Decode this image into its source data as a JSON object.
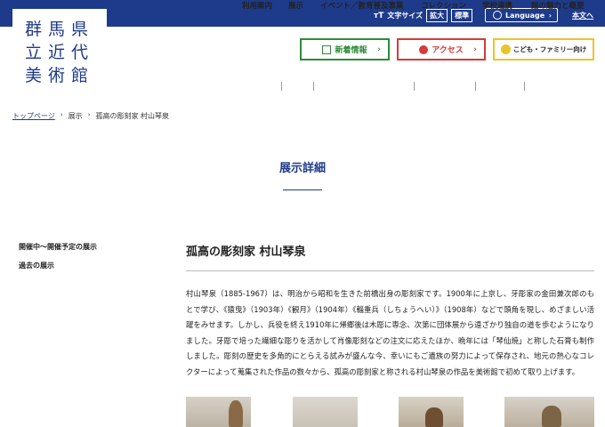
{
  "logo": {
    "lines": [
      "群馬県",
      "立近代",
      "美術館"
    ]
  },
  "utility": {
    "font_size_label": "文字サイズ",
    "enlarge": "拡大",
    "standard": "標準",
    "language": "Language",
    "main_text": "本文へ"
  },
  "cta": {
    "news": "新着情報",
    "access": "アクセス",
    "family": "こども・ファミリー向け"
  },
  "gnav": [
    "利用案内",
    "展示",
    "イベント／教育普及事業",
    "コレクション",
    "学校連携",
    "館の魅力と概要"
  ],
  "breadcrumb": {
    "home": "トップページ",
    "exhibit": "展示",
    "current": "孤高の彫刻家 村山琴泉"
  },
  "page_title": "展示詳細",
  "sidebar": [
    "開催中～開催予定の展示",
    "過去の展示"
  ],
  "article": {
    "title": "孤高の彫刻家 村山琴泉",
    "body": "村山琴泉（1885-1967）は、明治から昭和を生きた前橋出身の彫刻家です。1900年に上京し、牙彫家の金田兼次郎のもとで学び、《猿曳》（1903年）《観月》（1904年）《輜重兵（しちょうへい）》（1908年）などで頭角を現し、めざましい活躍をみせます。しかし、兵役を終え1910年に帰郷後は木彫に専念、次第に団体展から遠ざかり独自の道を歩むようになりました。牙彫で培った繊細な彫りを活かして肖像彫刻などの注文に応えたほか、晩年には「琴仙焼」と称した石膏も制作しました。彫刻の歴史を多角的にとらえる試みが盛んな今、幸いにもご遺族の努力によって保存され、地元の熱心なコレクターによって蒐集された作品の数々から、孤高の彫刻家と称される村山琴泉の作品を美術館で初めて取り上げます。"
  },
  "colors": {
    "brand": "#1e3a8a",
    "news": "#2e8b3a",
    "access": "#d63a3a",
    "family": "#e8c52a"
  }
}
